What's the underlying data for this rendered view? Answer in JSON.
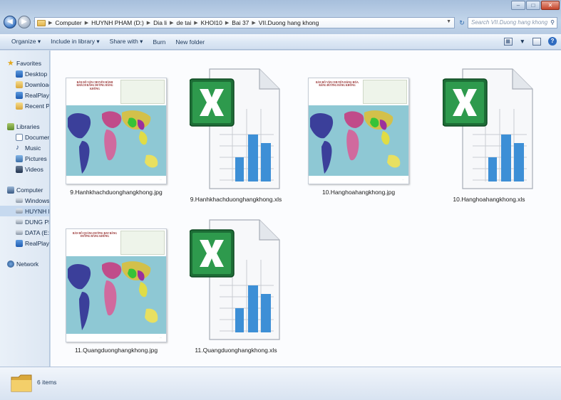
{
  "window": {
    "controls": {
      "minimize": "–",
      "maximize": "□",
      "close": "✕"
    }
  },
  "address": {
    "crumbs": [
      "Computer",
      "HUYNH PHAM (D:)",
      "Dia li",
      "de tai",
      "KHOI10",
      "Bai 37",
      "VII.Duong hang khong"
    ],
    "search_placeholder": "Search VII.Duong hang khong"
  },
  "toolbar": {
    "organize": "Organize ▾",
    "include": "Include in library ▾",
    "share": "Share with ▾",
    "burn": "Burn",
    "new_folder": "New folder"
  },
  "navpane": {
    "favorites": {
      "label": "Favorites",
      "items": [
        "Desktop",
        "Downloac",
        "RealPlaye",
        "Recent Pl"
      ]
    },
    "libraries": {
      "label": "Libraries",
      "items": [
        "Documen",
        "Music",
        "Pictures",
        "Videos"
      ]
    },
    "computer": {
      "label": "Computer",
      "items": [
        "Windows",
        "HUYNH P",
        "DUNG PH",
        "DATA (E:)",
        "RealPlaye"
      ]
    },
    "network": {
      "label": "Network"
    }
  },
  "files": [
    {
      "name": "9.Hanhkhachduonghangkhong.jpg",
      "type": "jpg",
      "thumb_title": "BẢN ĐỒ VẬN CHUYỂN HÀNH KHÁCH BẰNG ĐƯỜNG HÀNG KHÔNG"
    },
    {
      "name": "9.Hanhkhachduonghangkhong.xls",
      "type": "xls"
    },
    {
      "name": "10.Hanghoahangkhong.jpg",
      "type": "jpg",
      "thumb_title": "BẢN ĐỒ VẬN CHUYỂN HÀNG HÓA BẰNG ĐƯỜNG HÀNG KHÔNG"
    },
    {
      "name": "10.Hanghoahangkhong.xls",
      "type": "xls"
    },
    {
      "name": "11.Quangduonghangkhong.jpg",
      "type": "jpg",
      "thumb_title": "BẢN ĐỒ QUÃNG ĐƯỜNG BAY BẰNG ĐƯỜNG HÀNG KHÔNG"
    },
    {
      "name": "11.Quangduonghangkhong.xls",
      "type": "xls"
    }
  ],
  "status": {
    "item_count": "6 items"
  }
}
